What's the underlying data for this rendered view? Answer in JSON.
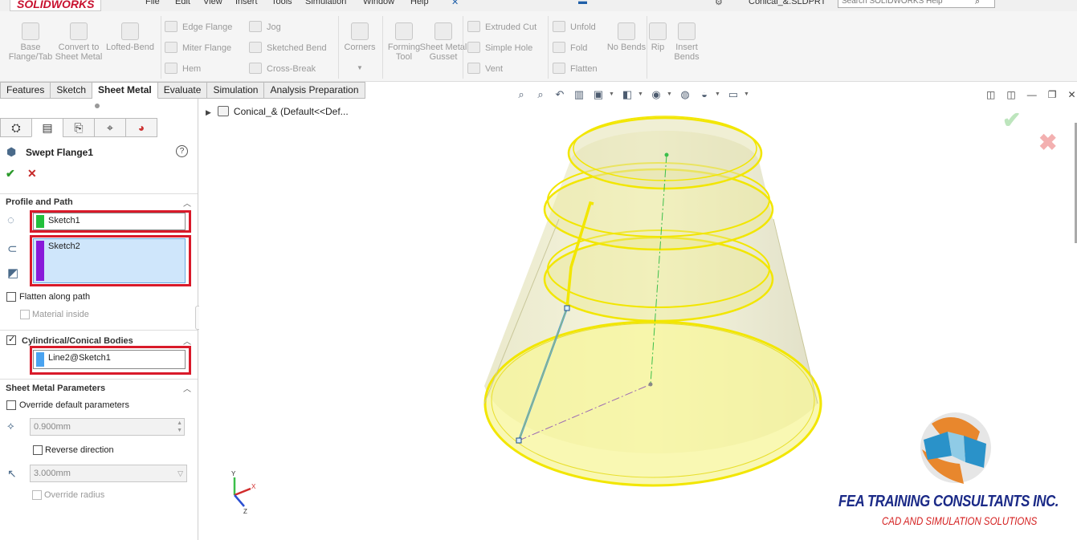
{
  "app": {
    "logo": "SOLIDWORKS",
    "menu": [
      "File",
      "Edit",
      "View",
      "Insert",
      "Tools",
      "Simulation",
      "Window",
      "Help"
    ],
    "document_title": "Conical_&.SLDPRT",
    "help_search_placeholder": "Search SOLIDWORKS Help"
  },
  "command_manager": {
    "big_tools": [
      {
        "label": "Base Flange/Tab",
        "icon": "base-flange-icon"
      },
      {
        "label": "Convert to Sheet Metal",
        "icon": "convert-sheet-metal-icon"
      },
      {
        "label": "Lofted-Bend",
        "icon": "lofted-bend-icon"
      }
    ],
    "col1": [
      {
        "label": "Edge Flange",
        "icon": "edge-flange-icon"
      },
      {
        "label": "Miter Flange",
        "icon": "miter-flange-icon"
      },
      {
        "label": "Hem",
        "icon": "hem-icon"
      }
    ],
    "col2": [
      {
        "label": "Jog",
        "icon": "jog-icon"
      },
      {
        "label": "Sketched Bend",
        "icon": "sketched-bend-icon"
      },
      {
        "label": "Cross-Break",
        "icon": "cross-break-icon"
      }
    ],
    "corners": "Corners",
    "big_tools2": [
      {
        "label": "Forming Tool",
        "icon": "forming-tool-icon"
      },
      {
        "label": "Sheet Metal Gusset",
        "icon": "gusset-icon"
      }
    ],
    "col3": [
      {
        "label": "Extruded Cut",
        "icon": "extruded-cut-icon"
      },
      {
        "label": "Simple Hole",
        "icon": "simple-hole-icon"
      },
      {
        "label": "Vent",
        "icon": "vent-icon"
      }
    ],
    "col4": [
      {
        "label": "Unfold",
        "icon": "unfold-icon"
      },
      {
        "label": "Fold",
        "icon": "fold-icon"
      },
      {
        "label": "Flatten",
        "icon": "flatten-icon"
      }
    ],
    "big_tools3": [
      {
        "label": "No Bends",
        "icon": "no-bends-icon"
      },
      {
        "label": "Rip",
        "icon": "rip-icon"
      },
      {
        "label": "Insert Bends",
        "icon": "insert-bends-icon"
      }
    ]
  },
  "tabs": [
    {
      "label": "Features",
      "active": false
    },
    {
      "label": "Sketch",
      "active": false
    },
    {
      "label": "Sheet Metal",
      "active": true
    },
    {
      "label": "Evaluate",
      "active": false
    },
    {
      "label": "Simulation",
      "active": false
    },
    {
      "label": "Analysis Preparation",
      "active": false
    }
  ],
  "property_manager": {
    "title": "Swept Flange1",
    "profile_path": {
      "heading": "Profile and Path",
      "profile_value": "Sketch1",
      "path_value": "Sketch2",
      "profile_color": "#22c03c",
      "path_color": "#8a1ad9"
    },
    "flatten_along_path": "Flatten along path",
    "material_inside": "Material inside",
    "conical": {
      "heading": "Cylindrical/Conical Bodies",
      "value": "Line2@Sketch1",
      "color": "#4aa3f0"
    },
    "sheet_metal_params": {
      "heading": "Sheet Metal Parameters",
      "override_default": "Override default parameters",
      "thickness": "0.900mm",
      "reverse_direction": "Reverse direction",
      "radius": "3.000mm",
      "override_radius": "Override radius"
    }
  },
  "feature_tree": {
    "item": "Conical_&  (Default<<Def..."
  },
  "triad_labels": {
    "x": "X",
    "y": "Y",
    "z": "Z"
  },
  "watermark": {
    "title": "FEA TRAINING  CONSULTANTS INC.",
    "subtitle": "CAD AND SIMULATION SOLUTIONS"
  },
  "colors": {
    "accent_red": "#d91a2a",
    "model_fill": "#f7f59a",
    "model_edge": "#f2e600",
    "brand_blue": "#1b2a87"
  }
}
